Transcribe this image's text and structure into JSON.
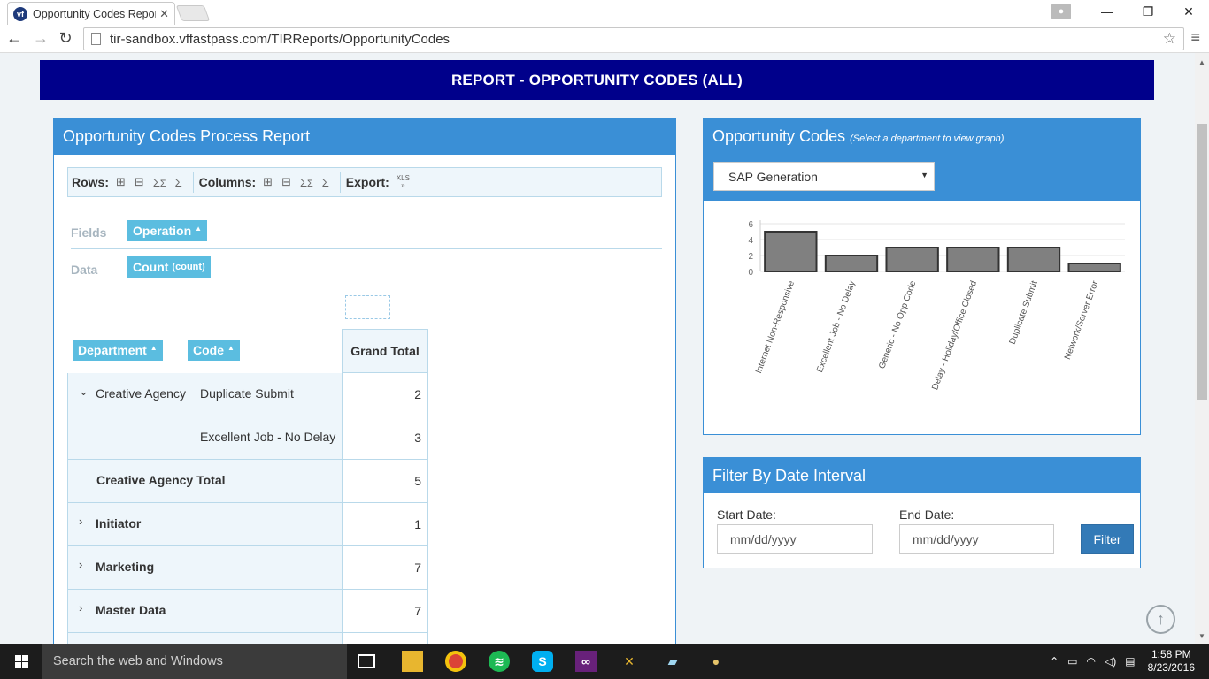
{
  "browser": {
    "tab_title": "Opportunity Codes Repor",
    "favicon_text": "vf",
    "url": "tir-sandbox.vffastpass.com/TIRReports/OpportunityCodes"
  },
  "banner": {
    "title": "REPORT - OPPORTUNITY CODES (ALL)"
  },
  "left_panel": {
    "title": "Opportunity Codes Process Report",
    "toolbar": {
      "rows_label": "Rows:",
      "columns_label": "Columns:",
      "export_label": "Export:",
      "export_format": "XLS"
    },
    "fields_label": "Fields",
    "data_label": "Data",
    "field_chip": "Operation",
    "data_chip": "Count",
    "data_chip_sub": "(count)",
    "row_headers": [
      "Department",
      "Code"
    ],
    "grand_total_label": "Grand Total",
    "rows": [
      {
        "dept": "Creative Agency",
        "code": "Duplicate Submit",
        "value": "2"
      },
      {
        "dept": "",
        "code": "Excellent Job - No Delay",
        "value": "3"
      },
      {
        "total_label": "Creative Agency Total",
        "value": "5"
      },
      {
        "dept": "Initiator",
        "value": "1"
      },
      {
        "dept": "Marketing",
        "value": "7"
      },
      {
        "dept": "Master Data",
        "value": "7"
      }
    ]
  },
  "chart_panel": {
    "title": "Opportunity Codes",
    "subtitle": "(Select a department to view graph)",
    "selected_department": "SAP Generation"
  },
  "chart_data": {
    "type": "bar",
    "categories": [
      "Internet Non-Responsive",
      "Excellent Job - No Delay",
      "Generic - No Opp Code",
      "Delay - Holiday/Office Closed",
      "Duplicate Submit",
      "Network/Server Error"
    ],
    "values": [
      5,
      2,
      3,
      3,
      3,
      1
    ],
    "ylim": [
      0,
      6
    ],
    "yticks": [
      "0",
      "2",
      "4",
      "6"
    ],
    "bar_color": "#808080"
  },
  "filter_panel": {
    "title": "Filter By Date Interval",
    "start_label": "Start Date:",
    "end_label": "End Date:",
    "start_placeholder": "mm/dd/yyyy",
    "end_placeholder": "mm/dd/yyyy",
    "button_label": "Filter"
  },
  "taskbar": {
    "search_placeholder": "Search the web and Windows",
    "time": "1:58 PM",
    "date": "8/23/2016"
  }
}
